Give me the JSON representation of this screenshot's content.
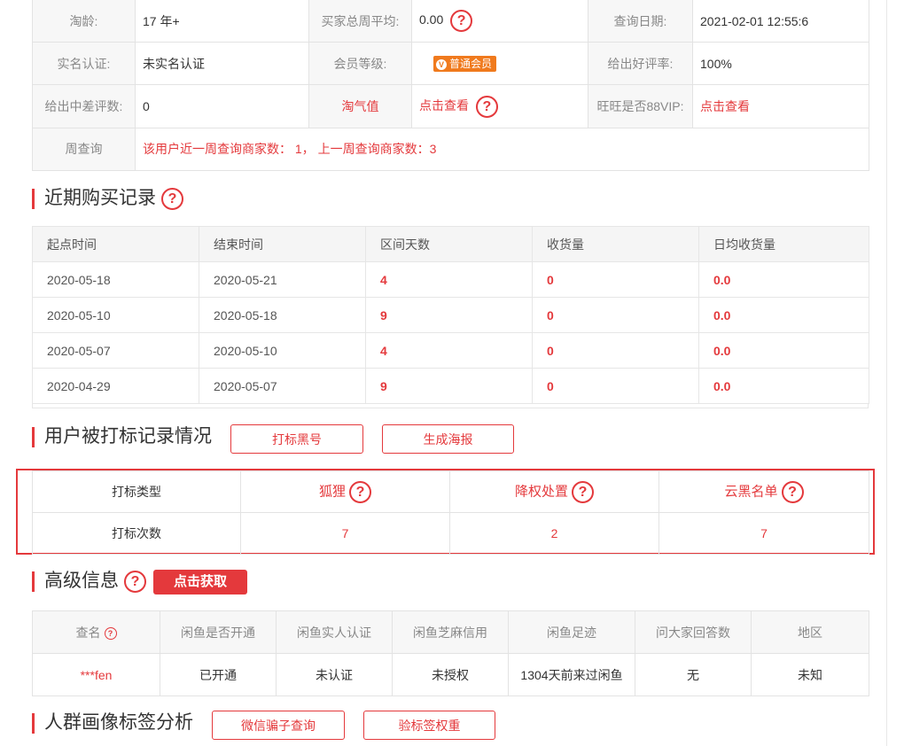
{
  "info": {
    "row1": {
      "age_label": "淘龄:",
      "age_value": "17 年+",
      "weekly_avg_label": "买家总周平均:",
      "weekly_avg_value": "0.00",
      "query_date_label": "查询日期:",
      "query_date_value": "2021-02-01 12:55:6"
    },
    "row2": {
      "realname_label": "实名认证:",
      "realname_value": "未实名认证",
      "member_label": "会员等级:",
      "member_badge": "普通会员",
      "good_rate_label": "给出好评率:",
      "good_rate_value": "100%"
    },
    "row3": {
      "bad_label": "给出中差评数:",
      "bad_value": "0",
      "taoqi_label": "淘气值",
      "taoqi_link": "点击查看",
      "vip_label": "旺旺是否88VIP:",
      "vip_link": "点击查看"
    },
    "row4": {
      "weekly_label": "周查询",
      "weekly_value": "该用户近一周查询商家数： 1， 上一周查询商家数：3"
    }
  },
  "purchase": {
    "title": "近期购买记录",
    "headers": [
      "起点时间",
      "结束时间",
      "区间天数",
      "收货量",
      "日均收货量"
    ],
    "rows": [
      [
        "2020-05-18",
        "2020-05-21",
        "4",
        "0",
        "0.0"
      ],
      [
        "2020-05-10",
        "2020-05-18",
        "9",
        "0",
        "0.0"
      ],
      [
        "2020-05-07",
        "2020-05-10",
        "4",
        "0",
        "0.0"
      ],
      [
        "2020-04-29",
        "2020-05-07",
        "9",
        "0",
        "0.0"
      ]
    ]
  },
  "marking": {
    "title": "用户被打标记录情况",
    "btn_blacklist": "打标黑号",
    "btn_poster": "生成海报",
    "type_label": "打标类型",
    "count_label": "打标次数",
    "types": [
      "狐狸",
      "降权处置",
      "云黑名单"
    ],
    "counts": [
      "7",
      "2",
      "7"
    ]
  },
  "advanced": {
    "title": "高级信息",
    "btn_get": "点击获取",
    "headers": [
      "查名",
      "闲鱼是否开通",
      "闲鱼实人认证",
      "闲鱼芝麻信用",
      "闲鱼足迹",
      "问大家回答数",
      "地区"
    ],
    "row": [
      "***fen",
      "已开通",
      "未认证",
      "未授权",
      "1304天前来过闲鱼",
      "无",
      "未知"
    ]
  },
  "crowd": {
    "title": "人群画像标签分析",
    "btn_wechat": "微信骗子查询",
    "btn_weight": "验标签权重"
  },
  "colors": {
    "accent": "#e4393c",
    "badge": "#f07a1d"
  },
  "icons": {
    "help": "question-circle-icon",
    "member": "v-badge-icon"
  }
}
